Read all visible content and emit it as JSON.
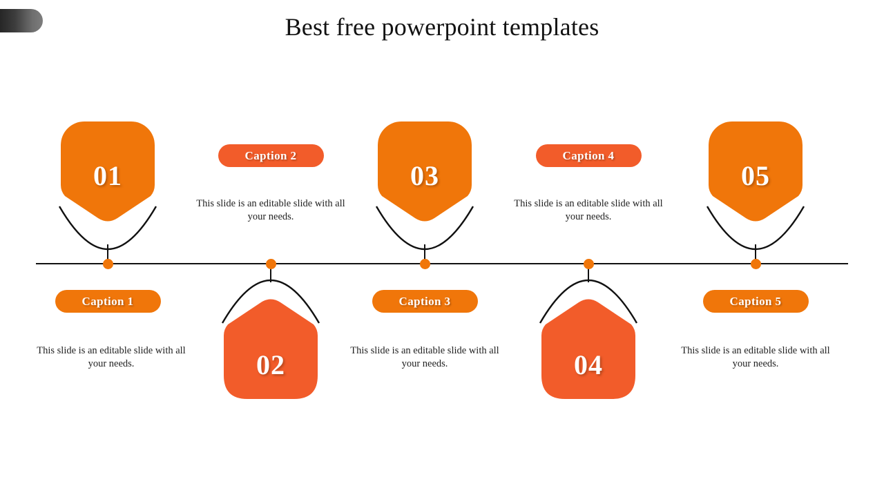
{
  "slide": {
    "title": "Best free powerpoint templates",
    "background_color": "#FFFFFF",
    "corner_tab_icon": "gradient-tab-shape"
  },
  "theme": {
    "accent_primary": "#F0760A",
    "accent_secondary": "#F25C2A",
    "line_color": "#111111",
    "text_color": "#222222",
    "number_text_color": "#FFFFFF"
  },
  "timeline": {
    "axis_label": "horizontal-timeline-axis",
    "dot_count": 5,
    "items": [
      {
        "number": "01",
        "caption": "Caption 1",
        "description": "This slide is an editable slide with all your needs.",
        "color": "#F0760A",
        "node_position": "above",
        "caption_position": "below"
      },
      {
        "number": "02",
        "caption": "Caption 2",
        "description": "This slide is an editable slide with all your needs.",
        "color": "#F25C2A",
        "node_position": "below",
        "caption_position": "above"
      },
      {
        "number": "03",
        "caption": "Caption 3",
        "description": "This slide is an editable slide with all your needs.",
        "color": "#F0760A",
        "node_position": "above",
        "caption_position": "below"
      },
      {
        "number": "04",
        "caption": "Caption 4",
        "description": "This slide is an editable slide with all your needs.",
        "color": "#F25C2A",
        "node_position": "below",
        "caption_position": "above"
      },
      {
        "number": "05",
        "caption": "Caption 5",
        "description": "This slide is an editable slide with all your needs.",
        "color": "#F0760A",
        "node_position": "above",
        "caption_position": "below"
      }
    ]
  }
}
